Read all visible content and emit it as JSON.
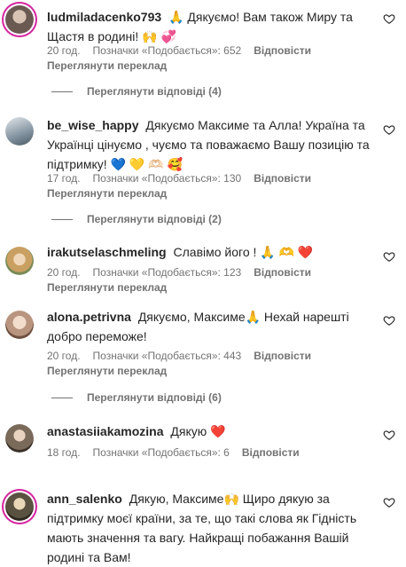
{
  "labels": {
    "reply": "Відповісти",
    "translate": "Переглянути переклад",
    "likes_prefix": "Позначки «Подобається»: "
  },
  "comments": [
    {
      "username": "ludmiladacenko793",
      "text": "🙏 Дякуємо! Вам також Миру та Щастя в родині! 🙌 💞",
      "time": "20 год.",
      "likes": "Позначки «Подобається»: 652",
      "replies": "Переглянути відповіді (4)",
      "avatar_color": "#6a5a52"
    },
    {
      "username": "be_wise_happy",
      "text": "Дякуємо Максиме та Алла! Україна та Українці цінуємо , чуємо та поважаємо Вашу позицію та підтримку! 💙 💛 🫶🏻 🥰",
      "time": "17 год.",
      "likes": "Позначки «Подобається»: 130",
      "replies": "Переглянути відповіді (2)",
      "avatar_color": "#8a9aa6"
    },
    {
      "username": "irakutselaschmeling",
      "text": "Славімо його ! 🙏 🫶 ❤️",
      "time": "20 год.",
      "likes": "Позначки «Подобається»: 123",
      "replies": "",
      "avatar_color": "#c9a062"
    },
    {
      "username": "alona.petrivna",
      "text": "Дякуємо, Максиме🙏 Нехай нарешті добро переможе!",
      "time": "20 год.",
      "likes": "Позначки «Подобається»: 443",
      "replies": "Переглянути відповіді (6)",
      "avatar_color": "#b99580"
    },
    {
      "username": "anastasiiakamozina",
      "text": "Дякую ❤️",
      "time": "18 год.",
      "likes": "Позначки «Подобається»: 6",
      "replies": "",
      "avatar_color": "#7a6a5a"
    },
    {
      "username": "ann_salenko",
      "text": "Дякую, Максиме🙌 Щиро дякую за підтримку моєї країни, за те, що такі слова як Гідність мають значення та вагу. Найкращі побажання Вашій родині та Вам!",
      "time": "",
      "likes": "",
      "replies": "",
      "avatar_color": "#5a5240"
    }
  ]
}
